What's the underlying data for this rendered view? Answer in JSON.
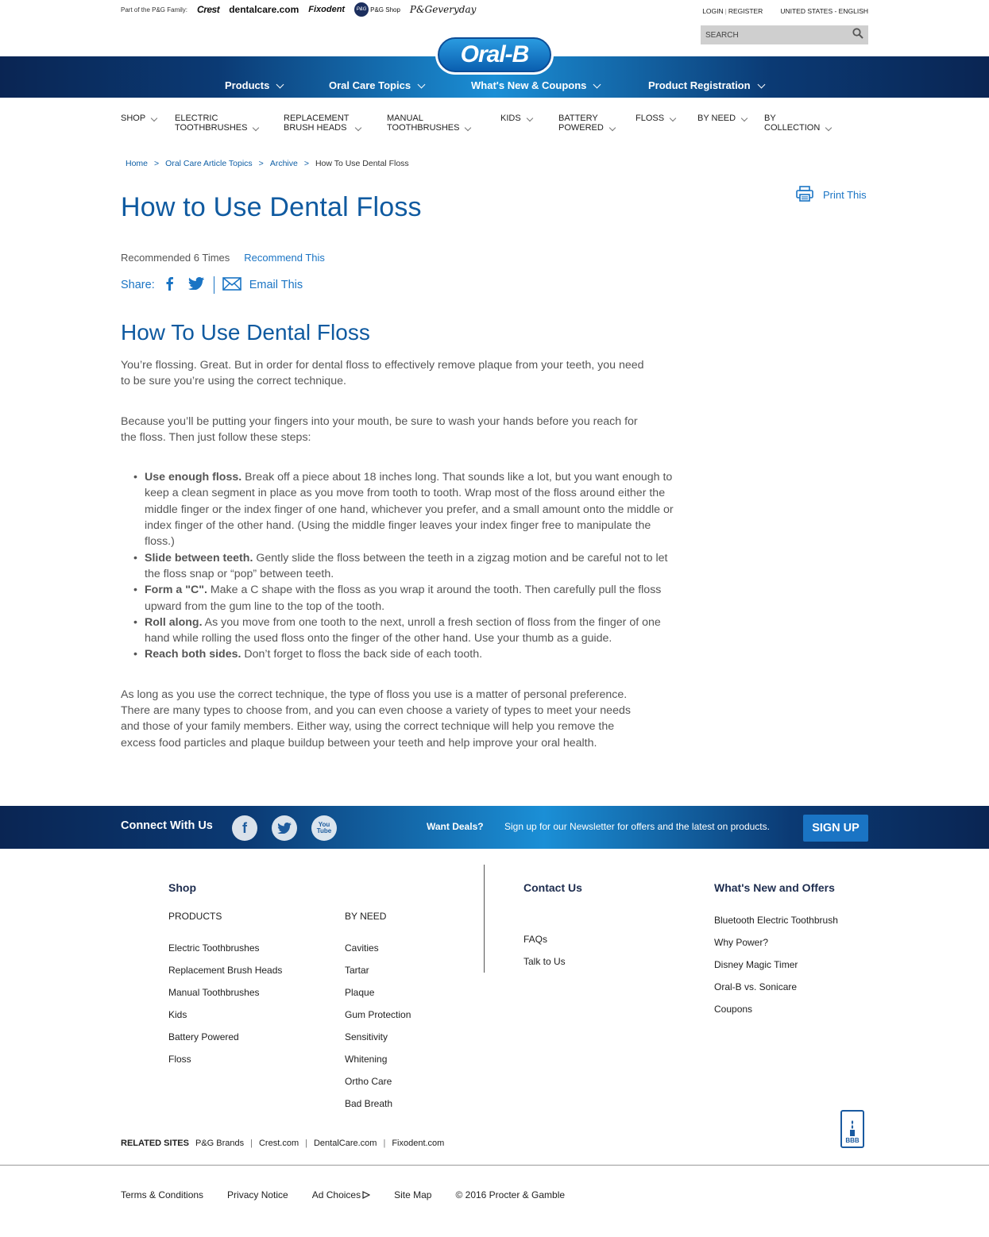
{
  "topbar": {
    "family_label": "Part of the P&G Family:",
    "brands": [
      "Crest",
      "dentalcare.com",
      "Fixodent",
      "P&G Shop",
      "P&Geveryday"
    ],
    "login": "LOGIN",
    "register": "REGISTER",
    "country": "UNITED STATES - ENGLISH",
    "search_placeholder": "SEARCH"
  },
  "logo": "Oral-B",
  "main_nav": [
    "Products",
    "Oral Care Topics",
    "What's New & Coupons",
    "Product Registration"
  ],
  "sub_nav": [
    {
      "l1": "",
      "l2": "SHOP"
    },
    {
      "l1": "ELECTRIC",
      "l2": "TOOTHBRUSHES"
    },
    {
      "l1": "REPLACEMENT",
      "l2": "BRUSH HEADS"
    },
    {
      "l1": "MANUAL",
      "l2": "TOOTHBRUSHES"
    },
    {
      "l1": "",
      "l2": "KIDS"
    },
    {
      "l1": "BATTERY",
      "l2": "POWERED"
    },
    {
      "l1": "",
      "l2": "FLOSS"
    },
    {
      "l1": "",
      "l2": "BY NEED"
    },
    {
      "l1": "BY",
      "l2": "COLLECTION"
    }
  ],
  "breadcrumb": [
    "Home",
    "Oral Care Article Topics",
    "Archive",
    "How To Use Dental Floss"
  ],
  "print_label": "Print This",
  "title": "How to Use Dental Floss",
  "recommended": "Recommended 6 Times",
  "recommend_link": "Recommend This",
  "share_label": "Share:",
  "email_label": "Email This",
  "article": {
    "heading": "How To Use Dental Floss",
    "p1": "You’re flossing. Great. But in order for dental floss to effectively remove plaque from your teeth, you need to be sure you’re using the correct technique.",
    "p2": "Because you’ll be putting your fingers into your mouth, be sure to wash your hands before you reach for the floss. Then just follow these steps:",
    "steps": [
      {
        "bold": "Use enough floss.",
        "text": " Break off a piece about 18 inches long. That sounds like a lot, but you want enough to keep a clean segment in place as you move from tooth to tooth. Wrap most of the floss around either the middle finger or the index finger of one hand, whichever you prefer, and a small amount onto the middle or index finger of the other hand. (Using the middle finger leaves your index finger free to manipulate the floss.)"
      },
      {
        "bold": "Slide between teeth.",
        "text": " Gently slide the floss between the teeth in a zigzag motion and be careful not to let the floss snap or “pop” between teeth."
      },
      {
        "bold": "Form a \"C\".",
        "text": " Make a C shape with the floss as you wrap it around the tooth. Then carefully pull the floss upward from the gum line to the top of the tooth."
      },
      {
        "bold": "Roll along.",
        "text": " As you move from one tooth to the next, unroll a fresh section of floss from the finger of one hand while rolling the used floss onto the finger of the other hand. Use your thumb as a guide."
      },
      {
        "bold": "Reach both sides.",
        "text": " Don’t forget to floss the back side of each tooth."
      }
    ],
    "p3": "As long as you use the correct technique, the type of floss you use is a matter of personal preference. There are many types to choose from, and you can even choose a variety of types to meet your needs and those of your family members. Either way, using the correct technique will help you remove the excess food particles and plaque buildup between your teeth and help improve your oral health."
  },
  "connect": {
    "label": "Connect With Us",
    "social": [
      "facebook",
      "twitter",
      "youtube"
    ],
    "youtube_text": "You Tube",
    "deals_q": "Want Deals?",
    "deals_text": "Sign up for our Newsletter for offers and the latest on products.",
    "signup": "SIGN UP"
  },
  "footer": {
    "shop_heading": "Shop",
    "products_heading": "PRODUCTS",
    "products": [
      "Electric Toothbrushes",
      "Replacement Brush Heads",
      "Manual Toothbrushes",
      "Kids",
      "Battery Powered",
      "Floss"
    ],
    "byneed_heading": "BY NEED",
    "byneed": [
      "Cavities",
      "Tartar",
      "Plaque",
      "Gum Protection",
      "Sensitivity",
      "Whitening",
      "Ortho Care",
      "Bad Breath"
    ],
    "contact_heading": "Contact Us",
    "contact": [
      "FAQs",
      "Talk to Us"
    ],
    "whatsnew_heading": "What's New and Offers",
    "whatsnew": [
      "Bluetooth Electric Toothbrush",
      "Why Power?",
      "Disney Magic Timer",
      "Oral-B vs. Sonicare",
      "Coupons"
    ],
    "related_label": "RELATED SITES",
    "related": [
      "P&G Brands",
      "Crest.com",
      "DentalCare.com",
      "Fixodent.com"
    ],
    "bbb": "BBB",
    "legal": [
      "Terms & Conditions",
      "Privacy Notice",
      "Ad Choices",
      "Site Map",
      "© 2016 Procter & Gamble"
    ]
  },
  "colors": {
    "brand_blue": "#0f5aa0",
    "link_blue": "#1a74c4",
    "navy": "#0a2553"
  }
}
